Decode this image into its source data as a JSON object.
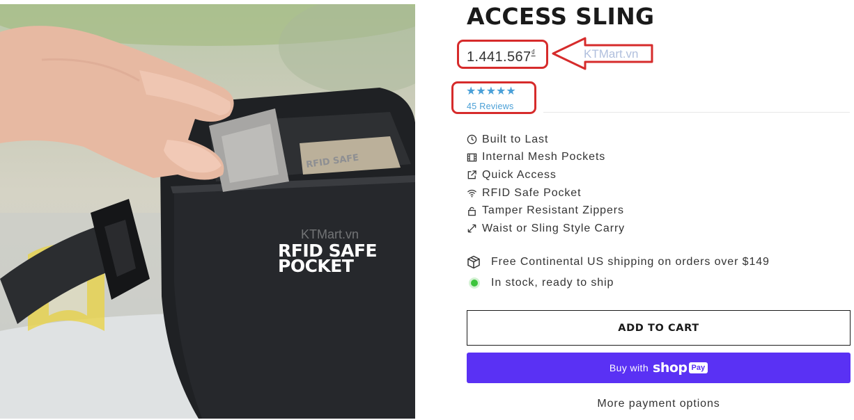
{
  "product": {
    "title": "ACCESS SLING",
    "price": "1.441.567",
    "currency_symbol": "₫",
    "rating": 5,
    "stars": "★★★★★",
    "reviews_label": "45 Reviews"
  },
  "photo": {
    "caption": "RFID SAFE\nPOCKET",
    "watermark": "KTMart.vn",
    "pocket_label": "RFID SAFE"
  },
  "annotation": {
    "watermark": "KTMart.vn",
    "highlight_color": "#d62b2b"
  },
  "features": [
    {
      "icon": "clock-icon",
      "label": "Built to Last"
    },
    {
      "icon": "film-icon",
      "label": "Internal Mesh Pockets"
    },
    {
      "icon": "external-link-icon",
      "label": "Quick Access"
    },
    {
      "icon": "wifi-icon",
      "label": "RFID Safe Pocket"
    },
    {
      "icon": "lock-icon",
      "label": "Tamper Resistant Zippers"
    },
    {
      "icon": "resize-arrow-icon",
      "label": "Waist or Sling Style Carry"
    }
  ],
  "shipping": {
    "icon": "box-icon",
    "label": "Free Continental US shipping on orders over $149"
  },
  "stock": {
    "status_color": "#3cc43c",
    "label": "In stock, ready to ship"
  },
  "actions": {
    "add_to_cart": "ADD TO CART",
    "buy_with": "Buy with",
    "shop_word": "shop",
    "pay_badge": "Pay",
    "more_payment": "More payment options"
  },
  "colors": {
    "shop_pay": "#5a31f4",
    "stars": "#4aa0d8",
    "reviews_link": "#4a9fd6"
  }
}
